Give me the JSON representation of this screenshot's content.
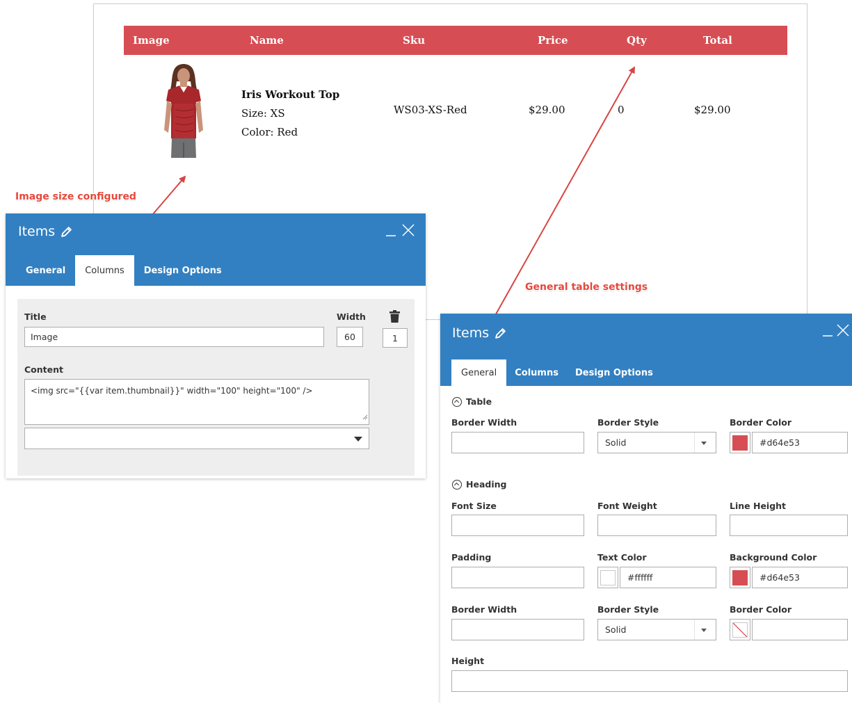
{
  "preview": {
    "table": {
      "headers": [
        "Image",
        "Name",
        "Sku",
        "Price",
        "Qty",
        "Total"
      ],
      "row": {
        "name": "Iris Workout Top",
        "size": "Size: XS",
        "color": "Color: Red",
        "sku": "WS03-XS-Red",
        "price": "$29.00",
        "qty": "0",
        "total": "$29.00"
      },
      "header_bg": "#d64e53"
    }
  },
  "annotations": {
    "image_size": "Image size configured",
    "general_settings": "General table settings",
    "color": "#e5483c"
  },
  "dialog_columns": {
    "title": "Items",
    "tabs": [
      "General",
      "Columns",
      "Design Options"
    ],
    "active_tab": "Columns",
    "title_label": "Title",
    "title_value": "Image",
    "width_label": "Width",
    "width_value": "60",
    "order_value": "1",
    "content_label": "Content",
    "content_value": "<img src=\"{{var item.thumbnail}}\" width=\"100\" height=\"100\" />",
    "header_bg": "#3280c2"
  },
  "dialog_general": {
    "title": "Items",
    "tabs": [
      "General",
      "Columns",
      "Design Options"
    ],
    "active_tab": "General",
    "table_section": "Table",
    "heading_section": "Heading",
    "table": {
      "border_width_label": "Border Width",
      "border_style_label": "Border Style",
      "border_style_value": "Solid",
      "border_color_label": "Border Color",
      "border_color_value": "#d64e53"
    },
    "heading": {
      "font_size_label": "Font Size",
      "font_weight_label": "Font Weight",
      "line_height_label": "Line Height",
      "padding_label": "Padding",
      "text_color_label": "Text Color",
      "text_color_value": "#ffffff",
      "background_color_label": "Background Color",
      "background_color_value": "#d64e53",
      "border_width_label": "Border Width",
      "border_style_label": "Border Style",
      "border_style_value": "Solid",
      "border_color_label": "Border Color",
      "height_label": "Height"
    }
  }
}
